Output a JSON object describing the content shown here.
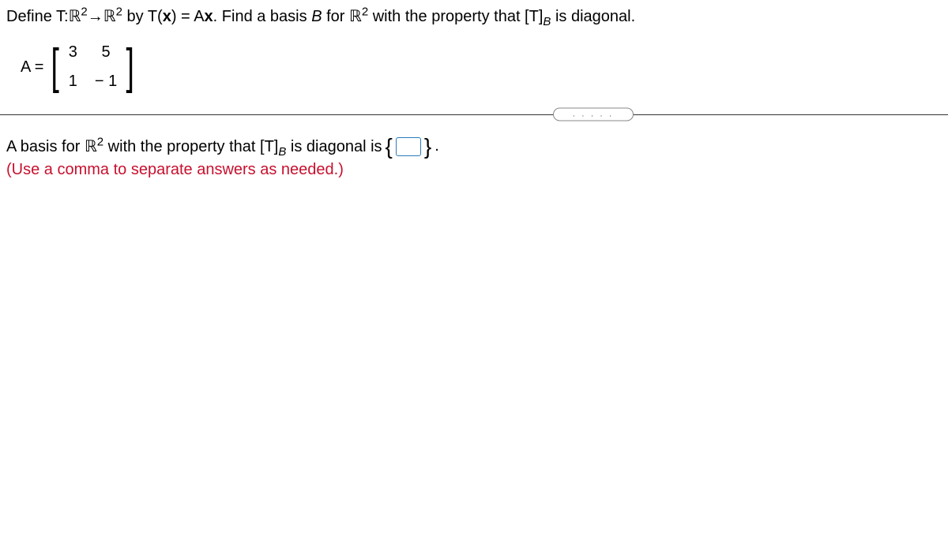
{
  "question": {
    "pre": "Define T:",
    "R": "ℝ",
    "sq": "2",
    "arrow": "→",
    "by": " by T(",
    "x": "x",
    "eqAx": ") = A",
    "x2": "x",
    "post": ". Find a basis ",
    "B": "B",
    "for": " for ",
    "with": " with the property that [T]",
    "Bsub": "B",
    "end": " is diagonal."
  },
  "matrix": {
    "label": "A =",
    "m11": "3",
    "m12": "5",
    "m21": "1",
    "m22": "− 1"
  },
  "divider": {
    "dots": ". . . . ."
  },
  "answer": {
    "pre": "A basis for ",
    "R": "ℝ",
    "sq": "2",
    "with": " with the property that [T]",
    "Bsub": "B",
    "mid": " is diagonal is ",
    "lb": "{",
    "rb": "}",
    "period": "."
  },
  "hint": "(Use a comma to separate answers as needed.)"
}
